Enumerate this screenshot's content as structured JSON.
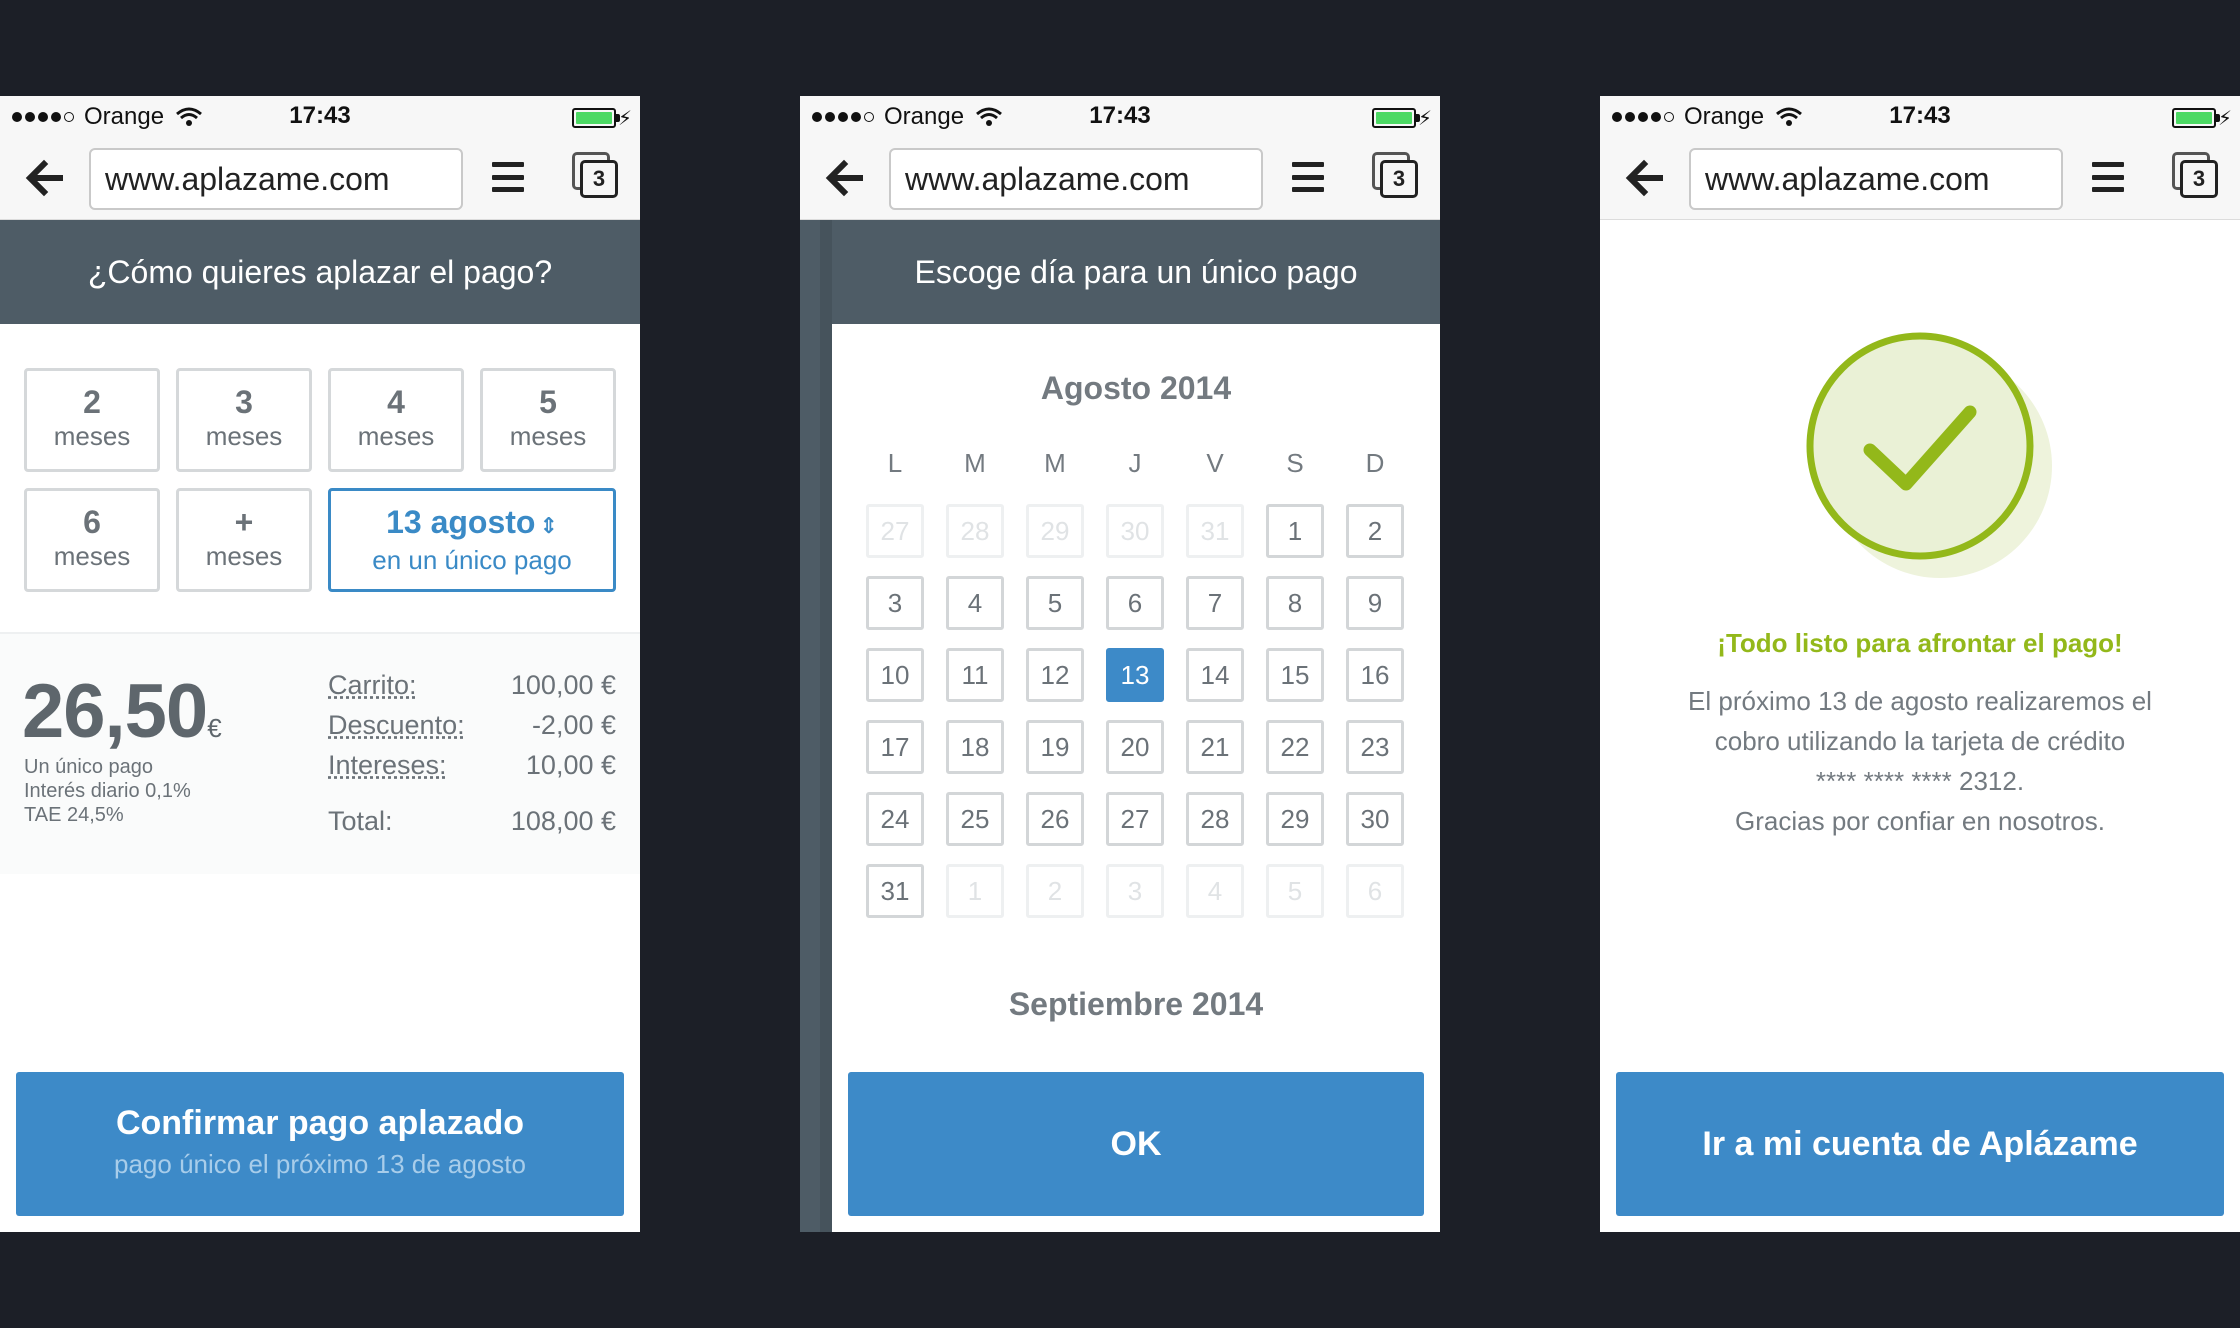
{
  "status": {
    "carrier": "Orange",
    "time": "17:43"
  },
  "browser": {
    "url": "www.aplazame.com",
    "tab_count": "3"
  },
  "screen1": {
    "header": "¿Cómo quieres aplazar el pago?",
    "options": [
      {
        "num": "2",
        "unit": "meses"
      },
      {
        "num": "3",
        "unit": "meses"
      },
      {
        "num": "4",
        "unit": "meses"
      },
      {
        "num": "5",
        "unit": "meses"
      },
      {
        "num": "6",
        "unit": "meses"
      },
      {
        "num": "+",
        "unit": "meses"
      }
    ],
    "single": {
      "date": "13 agosto",
      "arrows": "⇕",
      "label": "en un único pago"
    },
    "amount": "26,50",
    "currency": "€",
    "subtitle": "Un único pago",
    "interest_daily": "Interés diario 0,1%",
    "tae": "TAE 24,5%",
    "rows": [
      {
        "label": "Carrito:",
        "value": "100,00 €"
      },
      {
        "label": "Descuento:",
        "value": "-2,00 €"
      },
      {
        "label": "Intereses:",
        "value": "10,00 €"
      }
    ],
    "total": {
      "label": "Total:",
      "value": "108,00 €"
    },
    "confirm": {
      "title": "Confirmar pago aplazado",
      "subtitle": "pago único el próximo 13 de agosto"
    }
  },
  "screen2": {
    "header": "Escoge día para un único pago",
    "month": "Agosto 2014",
    "weekdays": [
      "L",
      "M",
      "M",
      "J",
      "V",
      "S",
      "D"
    ],
    "days": [
      "27",
      "28",
      "29",
      "30",
      "31",
      "1",
      "2",
      "3",
      "4",
      "5",
      "6",
      "7",
      "8",
      "9",
      "10",
      "11",
      "12",
      "13",
      "14",
      "15",
      "16",
      "17",
      "18",
      "19",
      "20",
      "21",
      "22",
      "23",
      "24",
      "25",
      "26",
      "27",
      "28",
      "29",
      "30",
      "31",
      "1",
      "2",
      "3",
      "4",
      "5",
      "6"
    ],
    "selected_day": "13",
    "next_month": "Septiembre 2014",
    "ok": "OK"
  },
  "screen3": {
    "title": "¡Todo listo para afrontar el pago!",
    "line1": "El próximo 13 de agosto realizaremos el",
    "line2": "cobro utilizando la tarjeta de crédito",
    "line3": "**** **** **** 2312.",
    "line4": "Gracias por confiar en nosotros.",
    "button": "Ir a mi cuenta de Aplázame"
  },
  "colors": {
    "accent": "#3d8ac8",
    "header": "#4e5c66",
    "success": "#93b81a",
    "background": "#1c1f27"
  }
}
